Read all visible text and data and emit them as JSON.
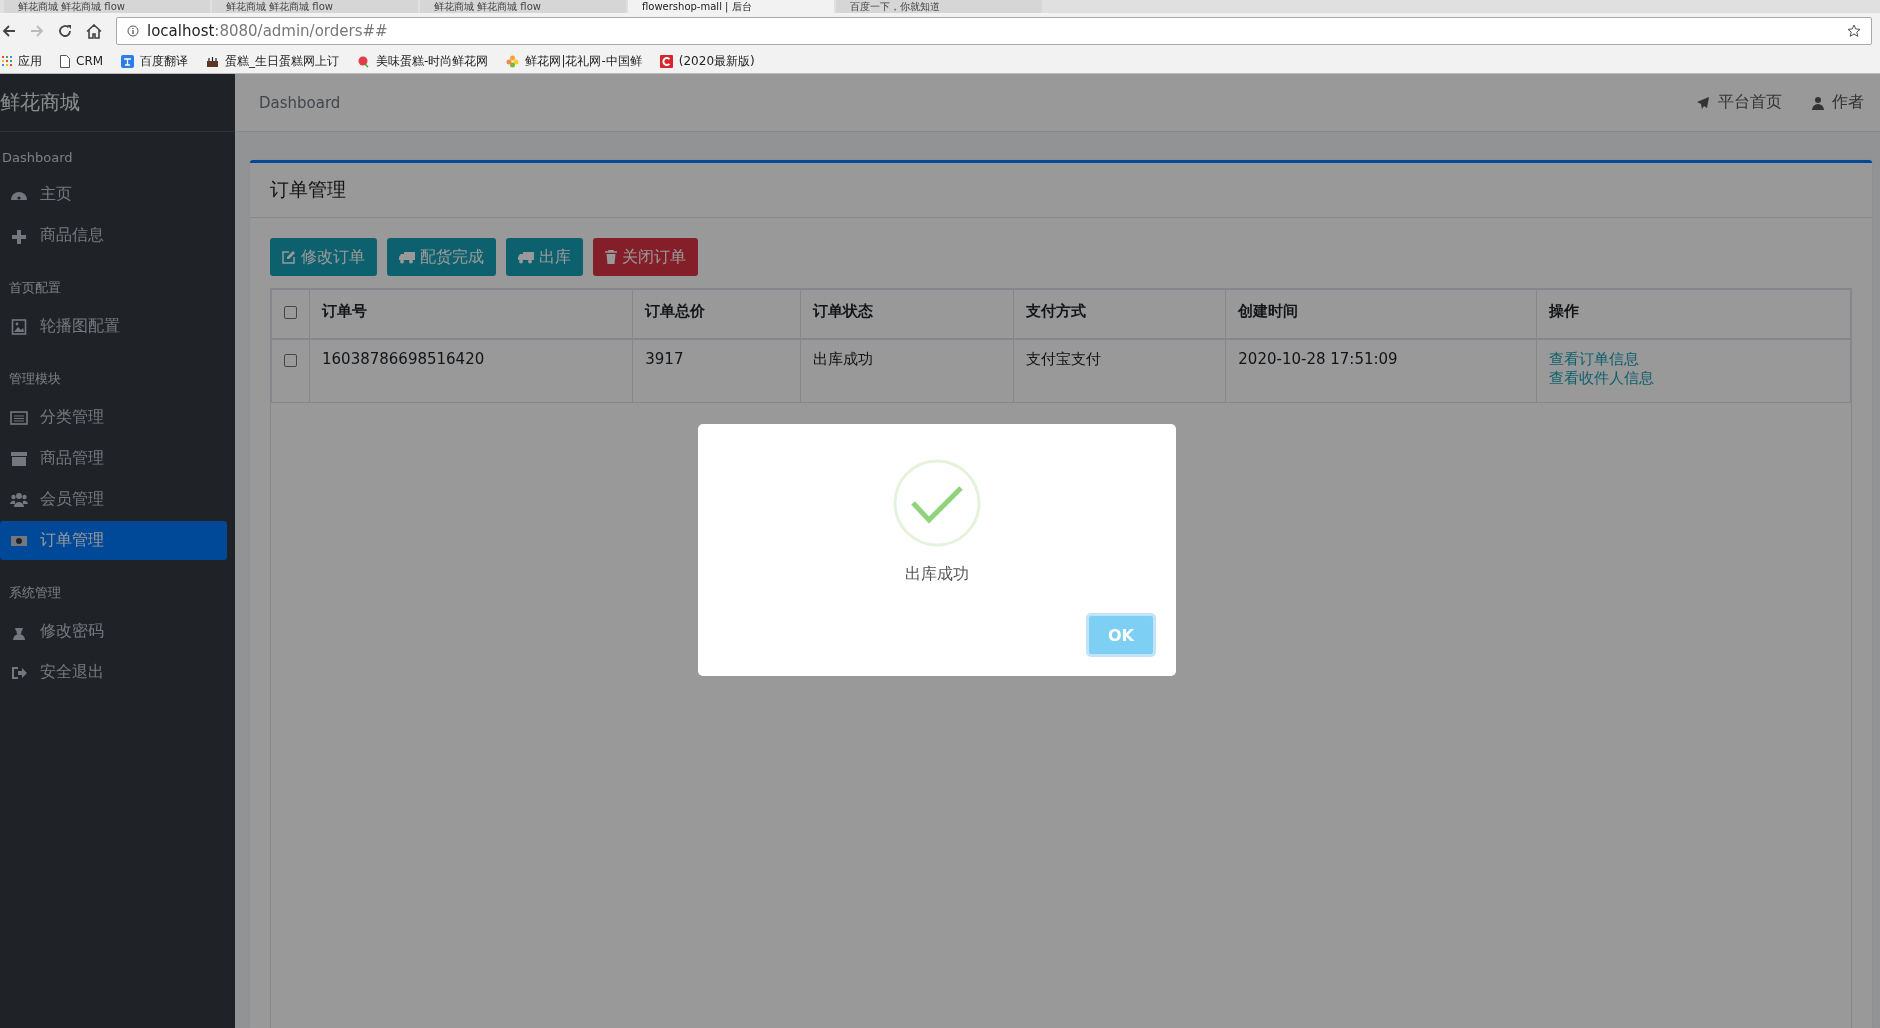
{
  "browser": {
    "tabs": [
      {
        "title": "鲜花商城 鲜花商城 flow",
        "selected": false
      },
      {
        "title": "鲜花商城 鲜花商城 flow",
        "selected": false
      },
      {
        "title": "鲜花商城 鲜花商城 flow",
        "selected": false
      },
      {
        "title": "flowershop-mall | 后台",
        "selected": true
      },
      {
        "title": "百度一下，你就知道",
        "selected": false
      }
    ],
    "address": {
      "host": "localhost",
      "path": ":8080/admin/orders##"
    },
    "bookmarks": [
      {
        "label": "应用"
      },
      {
        "label": "CRM"
      },
      {
        "label": "百度翻译"
      },
      {
        "label": "蛋糕_生日蛋糕网上订"
      },
      {
        "label": "美味蛋糕-时尚鲜花网"
      },
      {
        "label": "鲜花网|花礼网-中国鲜"
      },
      {
        "label": "(2020最新版)"
      }
    ]
  },
  "brand": "鲜花商城",
  "sidebar": {
    "sections": [
      {
        "heading": "Dashboard",
        "items": [
          {
            "label": "主页",
            "selected": false
          },
          {
            "label": "商品信息",
            "selected": false
          }
        ]
      },
      {
        "heading": "首页配置",
        "items": [
          {
            "label": "轮播图配置",
            "selected": false
          }
        ]
      },
      {
        "heading": "管理模块",
        "items": [
          {
            "label": "分类管理",
            "selected": false
          },
          {
            "label": "商品管理",
            "selected": false
          },
          {
            "label": "会员管理",
            "selected": false
          },
          {
            "label": "订单管理",
            "selected": true
          }
        ]
      },
      {
        "heading": "系统管理",
        "items": [
          {
            "label": "修改密码",
            "selected": false
          },
          {
            "label": "安全退出",
            "selected": false
          }
        ]
      }
    ]
  },
  "header": {
    "breadcrumb": "Dashboard",
    "links": [
      {
        "label": "平台首页"
      },
      {
        "label": "作者"
      }
    ]
  },
  "card": {
    "title": "订单管理",
    "toolbar": [
      {
        "label": "修改订单",
        "kind": "info"
      },
      {
        "label": "配货完成",
        "kind": "info"
      },
      {
        "label": "出库",
        "kind": "info"
      },
      {
        "label": "关闭订单",
        "kind": "danger"
      }
    ],
    "table": {
      "select_all": {
        "checked": false
      },
      "columns": [
        "订单号",
        "订单总价",
        "订单状态",
        "支付方式",
        "创建时间",
        "操作"
      ],
      "rows": [
        {
          "selected": false,
          "cells": [
            "16038786698516420",
            "3917",
            "出库成功",
            "支付宝支付",
            "2020-10-28 17:51:09"
          ],
          "actions": [
            "查看订单信息",
            "查看收件人信息"
          ]
        }
      ]
    }
  },
  "dialog": {
    "message": "出库成功",
    "button": "OK"
  }
}
